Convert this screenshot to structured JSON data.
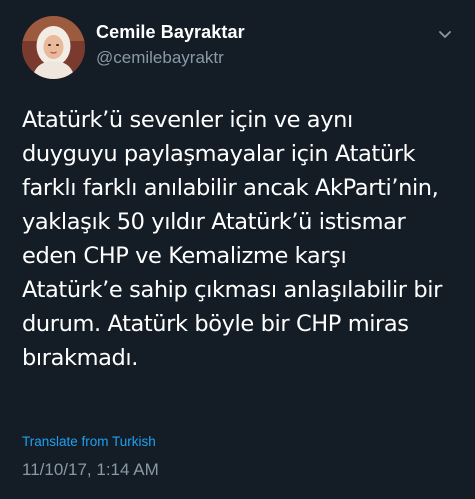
{
  "author": {
    "display_name": "Cemile Bayraktar",
    "handle": "@cemilebayraktr"
  },
  "tweet": {
    "text": "Atatürk’ü sevenler için ve aynı\nduyguyu paylaşmayalar için Atatürk\nfarklı farklı anılabilir ancak AkParti’nin,\nyaklaşık 50 yıldır Atatürk’ü istismar\neden CHP ve Kemalizme karşı\nAtatürk’e sahip çıkması anlaşılabilir bir\ndurum. Atatürk böyle bir CHP miras\nbırakmadı.",
    "translate_label": "Translate from Turkish",
    "timestamp": "11/10/17, 1:14 AM"
  },
  "icons": {
    "menu": "chevron-down-icon"
  },
  "colors": {
    "background": "#141d26",
    "text": "#ffffff",
    "muted": "#8899a6",
    "link": "#1da1f2"
  }
}
